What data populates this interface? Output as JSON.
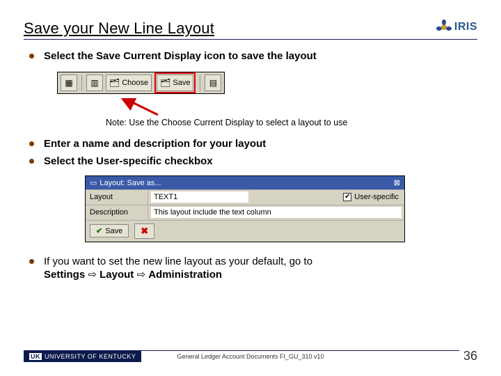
{
  "title": "Save your New Line Layout",
  "logo": {
    "brand": "IRIS"
  },
  "bullets": {
    "b1": "Select the Save Current Display icon to save the layout",
    "note": "Note: Use the Choose Current Display to select a layout to use",
    "b2": "Enter a name and description for your layout",
    "b3": "Select the User-specific checkbox",
    "b4_pre": "If you want to set the new line layout as your default, go to ",
    "b4_path1": "Settings",
    "b4_path2": "Layout",
    "b4_path3": "Administration"
  },
  "toolbar": {
    "choose": "Choose",
    "save": "Save"
  },
  "dialog": {
    "title": "Layout: Save as...",
    "layout_label": "Layout",
    "layout_value": "TEXT1",
    "user_specific": "User-specific",
    "desc_label": "Description",
    "desc_value": "This layout include the text column",
    "save_btn": "Save"
  },
  "footer": {
    "org": "UNIVERSITY OF KENTUCKY",
    "uk": "UK",
    "doc": "General Ledger Account Documents FI_GU_310 v10",
    "page": "36"
  }
}
